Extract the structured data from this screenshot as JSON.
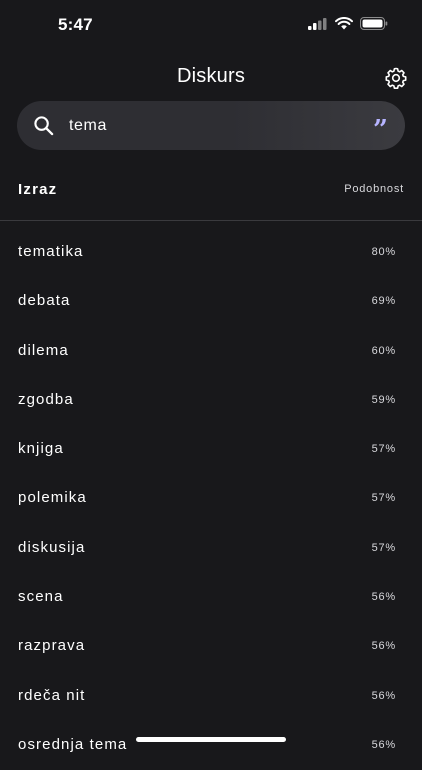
{
  "status": {
    "time": "5:47",
    "icons": [
      "cellular-signal-icon",
      "wifi-icon",
      "battery-icon"
    ]
  },
  "header": {
    "title": "Diskurs",
    "settings_icon": "gear-icon"
  },
  "search": {
    "value": "tema",
    "icon": "search-icon",
    "mode_icon": "quote-icon",
    "mode_color": "#b6b4ff"
  },
  "columns": {
    "term": "Izraz",
    "similarity": "Podobnost"
  },
  "results": [
    {
      "term": "tematika",
      "score": "80%"
    },
    {
      "term": "debata",
      "score": "69%"
    },
    {
      "term": "dilema",
      "score": "60%"
    },
    {
      "term": "zgodba",
      "score": "59%"
    },
    {
      "term": "knjiga",
      "score": "57%"
    },
    {
      "term": "polemika",
      "score": "57%"
    },
    {
      "term": "diskusija",
      "score": "57%"
    },
    {
      "term": "scena",
      "score": "56%"
    },
    {
      "term": "razprava",
      "score": "56%"
    },
    {
      "term": "rdeča nit",
      "score": "56%"
    },
    {
      "term": "osrednja tema",
      "score": "56%"
    }
  ],
  "colors": {
    "background": "#18181b",
    "search_bg": "#2e2e33",
    "text": "#ffffff"
  }
}
